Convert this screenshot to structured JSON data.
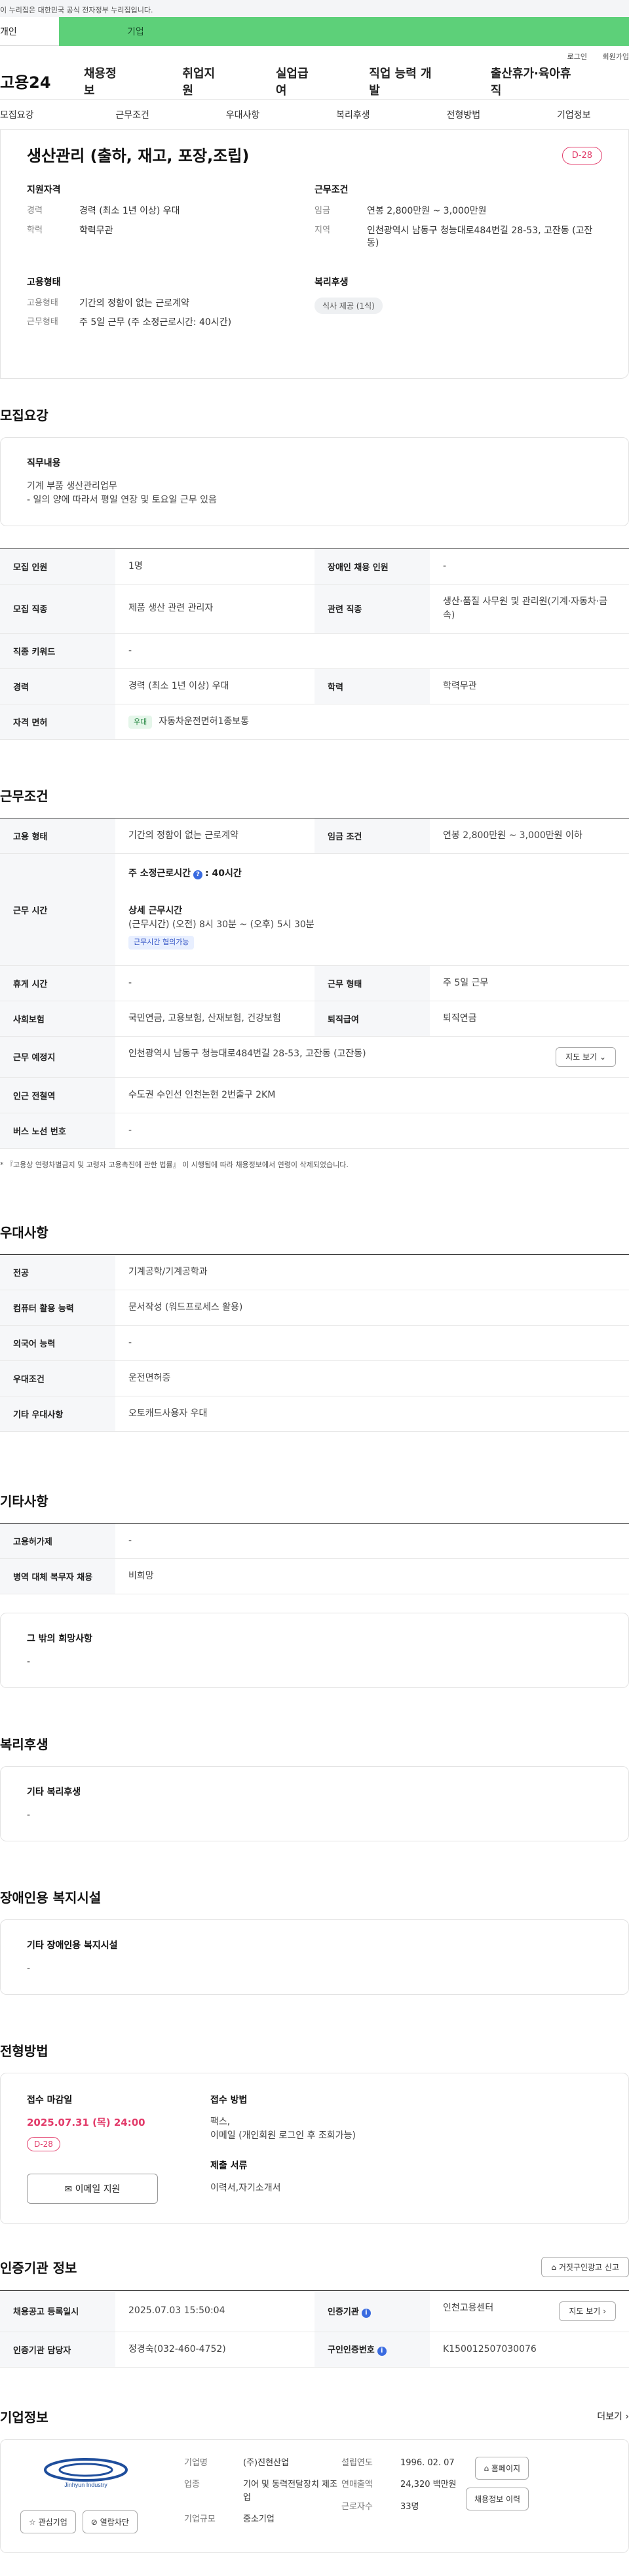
{
  "gov_banner": "이 누리집은 대한민국 공식 전자정부 누리집입니다.",
  "user_tabs": {
    "person": "개인",
    "company": "기업"
  },
  "util_links": [
    "로그인",
    "회원가입"
  ],
  "logo": "고용24",
  "gnb": [
    "채용정보",
    "취업지원",
    "실업급여",
    "직업 능력 개발",
    "출산휴가·육아휴직"
  ],
  "subnav": [
    "모집요강",
    "근무조건",
    "우대사항",
    "복리후생",
    "전형방법",
    "기업정보"
  ],
  "summary": {
    "title": "생산관리 (출하, 재고, 포장,조립)",
    "dday": "D-28",
    "qualification": {
      "heading": "지원자격",
      "career_label": "경력",
      "career_value": "경력 (최소 1년 이상) 우대",
      "edu_label": "학력",
      "edu_value": "학력무관"
    },
    "conditions": {
      "heading": "근무조건",
      "wage_label": "임금",
      "wage_value": "연봉 2,800만원 ~ 3,000만원",
      "area_label": "지역",
      "area_value": "인천광역시 남동구 청능대로484번길 28-53, 고잔동 (고잔동)"
    },
    "employment": {
      "heading": "고용형태",
      "type_label": "고용형태",
      "type_value": "기간의 정함이 없는 근로계약",
      "time_label": "근무형태",
      "time_value": "주 5일 근무 (주 소정근로시간: 40시간)"
    },
    "welfare": {
      "heading": "복리후생",
      "tag": "식사 제공 (1식)"
    }
  },
  "recruit": {
    "title": "모집요강",
    "duty_heading": "직무내용",
    "duty_lines": [
      "기계 부품  생산관리업무",
      "- 일의 양에 따라서 평일 연장 및 토요일 근무 있음"
    ],
    "rows": {
      "headcount_label": "모집 인원",
      "headcount": "1명",
      "disabled_label": "장애인 채용 인원",
      "disabled": "-",
      "job_label": "모집 직종",
      "job": "제품 생산 관련 관리자",
      "related_label": "관련 직종",
      "related": "생산·품질 사무원 및 관리원(기계·자동차·금속)",
      "keyword_label": "직종 키워드",
      "keyword": "-",
      "career_label": "경력",
      "career": "경력 (최소 1년 이상) 우대",
      "edu_label": "학력",
      "edu": "학력무관",
      "license_label": "자격 면허",
      "license_tag": "우대",
      "license": "자동차운전면허1종보통"
    }
  },
  "work": {
    "title": "근무조건",
    "emp_type_label": "고용 형태",
    "emp_type": "기간의 정함이 없는 근로계약",
    "wage_label": "임금 조건",
    "wage": "연봉 2,800만원 ~ 3,000만원 이하",
    "hours_label": "근무 시간",
    "std_hours_title": "주 소정근로시간",
    "std_hours_value": "40시간",
    "detail_hours_title": "상세 근무시간",
    "detail_hours": "(근무시간) (오전) 8시 30분 ~ (오후) 5시 30분",
    "detail_tag": "근무시간 협의가능",
    "rest_label": "휴게 시간",
    "rest": "-",
    "form_label": "근무 형태",
    "form": "주 5일 근무",
    "insurance_label": "사회보험",
    "insurance": "국민연금, 고용보험, 산재보험, 건강보험",
    "retire_label": "퇴직급여",
    "retire": "퇴직연금",
    "place_label": "근무 예정지",
    "place": "인천광역시 남동구 청능대로484번길 28-53, 고잔동 (고잔동)",
    "map_btn": "지도 보기",
    "station_label": "인근 전철역",
    "station": "수도권 수인선 인천논현 2번출구 2KM",
    "bus_label": "버스 노선 번호",
    "bus": "-",
    "note": "* 『고용상 연령차별금지 및 고령자 고용촉진에 관한 법률』 이 시행됨에 따라 채용정보에서 연령이 삭제되었습니다."
  },
  "pref": {
    "title": "우대사항",
    "major_label": "전공",
    "major": "기계공학/기계공학과",
    "computer_label": "컴퓨터 활용 능력",
    "computer": "문서작성 (워드프로세스 활용)",
    "lang_label": "외국어 능력",
    "lang": "-",
    "cond_label": "우대조건",
    "cond": "운전면허증",
    "etc_label": "기타 우대사항",
    "etc": "오토캐드사용자 우대"
  },
  "other": {
    "title": "기타사항",
    "subsidy_label": "고용허가제",
    "subsidy": "-",
    "military_label": "병역 대체 복무자 채용",
    "military": "비희망",
    "wish_heading": "그 밖의 희망사항",
    "wish": "-"
  },
  "welfare": {
    "title": "복리후생",
    "heading": "기타 복리후생",
    "value": "-"
  },
  "disabled_fac": {
    "title": "장애인용 복지시설",
    "heading": "기타 장애인용 복지시설",
    "value": "-"
  },
  "selection": {
    "title": "전형방법",
    "deadline_heading": "접수 마감일",
    "deadline": "2025.07.31 (목) 24:00",
    "dday": "D-28",
    "email_btn": "이메일 지원",
    "method_heading": "접수 방법",
    "method_lines": [
      "팩스,",
      "이메일 (개인회원 로그인 후 조회가능)"
    ],
    "docs_heading": "제출 서류",
    "docs": "이력서,자기소개서"
  },
  "agency": {
    "title": "인증기관 정보",
    "report_btn": "거짓구인광고 신고",
    "reg_date_label": "채용공고 등록일시",
    "reg_date": "2025.07.03 15:50:04",
    "agency_label": "인증기관",
    "agency": "인천고용센터",
    "map_btn": "지도 보기",
    "manager_label": "인증기관 담당자",
    "manager": "정경숙(032-460-4752)",
    "cert_label": "구인인증번호",
    "cert": "K150012507030076"
  },
  "company": {
    "title": "기업정보",
    "more": "더보기",
    "logo_text": "Jinhyun Industry",
    "fav_btn": "관심기업",
    "block_btn": "열람차단",
    "name_label": "기업명",
    "name": "(주)진현산업",
    "industry_label": "업종",
    "industry": "기어 및 동력전달장치 제조업",
    "size_label": "기업규모",
    "size": "중소기업",
    "founded_label": "설립연도",
    "founded": "1996. 02. 07",
    "sales_label": "연매출액",
    "sales": "24,320 백만원",
    "staff_label": "근로자수",
    "staff": "33명",
    "home_btn": "홈페이지",
    "history_btn": "채용정보 이력"
  }
}
